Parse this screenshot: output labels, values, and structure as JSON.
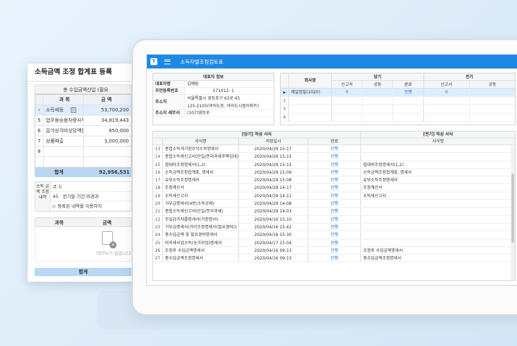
{
  "back": {
    "title": "소득금액 조정 합계표 등록",
    "subheader": "총 수입금액산입 (필요",
    "head": {
      "col1": "과 목",
      "col2": "금 액"
    },
    "rows": [
      {
        "num": "",
        "name": "소득세등",
        "amount": "53,700,200"
      },
      {
        "num": "5",
        "name": "업무용승용차량사적",
        "amount": "34,819,443"
      },
      {
        "num": "6",
        "name": "감가상각비상당액한",
        "amount": "650,000"
      },
      {
        "num": "7",
        "name": "상품매출",
        "amount": "3,000,000"
      },
      {
        "num": "8",
        "name": "",
        "amount": ""
      }
    ],
    "total_label": "합계",
    "total_value": "92,956,531",
    "income_label": "소득 금액 조정 내역",
    "income_code_label": "코 드",
    "income_code": "45",
    "income_desc": "전기말 기간 미경과",
    "income_note": "▷ 등록된 내역을 이용하지",
    "empty_head": {
      "col1": "과목",
      "col2": "금액"
    },
    "empty_text": "데이터가 없습니다",
    "total2_label": "합계"
  },
  "app": {
    "title": "소득자별조정검토표",
    "logo": "T"
  },
  "rep": {
    "header": "대표자 정보",
    "name_label": "대표자명",
    "name": "김예림",
    "rrn_label": "주민등록번호",
    "rrn": "571012-    1",
    "addr_label": "주소지",
    "addr1": "서울특별시 영등포구 63로 45",
    "addr2": "125-2105(여의도동, 여의도시범아파트)",
    "tax_label": "주소지 세무서",
    "tax": "(107)영등포"
  },
  "periods": {
    "name_header": "회사명",
    "current": "당기",
    "previous": "전기",
    "sub": [
      "신고서",
      "공동",
      "완료"
    ],
    "prev_sub": [
      "신고서",
      "공동"
    ],
    "rows": [
      {
        "num": "",
        "name": "제일정밀(1020)",
        "cur": [
          "0",
          "",
          "진행"
        ],
        "prev": [
          "0",
          ""
        ]
      },
      {
        "num": "2",
        "name": "",
        "cur": [
          "",
          "",
          ""
        ],
        "prev": [
          "",
          ""
        ]
      },
      {
        "num": "3",
        "name": "",
        "cur": [
          "",
          "",
          ""
        ],
        "prev": [
          "",
          ""
        ]
      },
      {
        "num": "4",
        "name": "",
        "cur": [
          "",
          "",
          ""
        ],
        "prev": [
          "",
          ""
        ]
      }
    ]
  },
  "lower": {
    "h_current": "[당기] 작성 서식",
    "h_previous": "[전기] 작성 서식",
    "col_form": "서식명",
    "col_saved": "저장일시",
    "col_done": "완료",
    "col_prev_form": "서식명",
    "rows": [
      {
        "n": "13",
        "form": "종합소득과기장수익소득명세서",
        "saved": "2020/04/29 15:17",
        "done": "진행",
        "prev": ""
      },
      {
        "n": "14",
        "form": "종합소득세신고서(단일/분리과세주택임대)",
        "saved": "2020/04/29 15:15",
        "done": "진행",
        "prev": ""
      },
      {
        "n": "15",
        "form": "접대비조정명세서(1,2)",
        "saved": "2020/04/29 15:15",
        "done": "진행",
        "prev": "접대비조정명세서(1,2)"
      },
      {
        "n": "16",
        "form": "소득금액조정합계표, 명세서",
        "saved": "2020/04/29 15:09",
        "done": "진행",
        "prev": "소득금액조정합계표, 명세서"
      },
      {
        "n": "17",
        "form": "유보소득조정명세서",
        "saved": "2020/04/29 15:08",
        "done": "진행",
        "prev": "유보소득조정명세서"
      },
      {
        "n": "18",
        "form": "조정계산서",
        "saved": "2020/04/29 14:17",
        "done": "진행",
        "prev": "조정계산서"
      },
      {
        "n": "19",
        "form": "소득세신고서",
        "saved": "2020/04/29 14:11",
        "done": "진행",
        "prev": "소득세신고서"
      },
      {
        "n": "20",
        "form": "가부금명세서(4번/소득공제)",
        "saved": "2020/04/29 14:08",
        "done": "진행",
        "prev": ""
      },
      {
        "n": "21",
        "form": "종합소득세신고서(단일/분리과세)",
        "saved": "2020/04/29 14:03",
        "done": "진행",
        "prev": ""
      },
      {
        "n": "22",
        "form": "무실감가자를명세서(가증명서)",
        "saved": "2020/04/16 15:10",
        "done": "진행",
        "prev": ""
      },
      {
        "n": "23",
        "form": "기부금명세서(가이조정명세서(필요경비))",
        "saved": "2020/04/16 15:42",
        "done": "진행",
        "prev": ""
      },
      {
        "n": "24",
        "form": "총수입금액 및 필요경비명세서",
        "saved": "2020/04/16 15:30",
        "done": "진행",
        "prev": ""
      },
      {
        "n": "25",
        "form": "비과세사업소득(농가부업)명세서",
        "saved": "2020/04/17 15:04",
        "done": "진행",
        "prev": ""
      },
      {
        "n": "26",
        "form": "조정후 수입금액명세서",
        "saved": "2020/04/16 09:13",
        "done": "진행",
        "prev": "조정후 수입금액명세서"
      },
      {
        "n": "27",
        "form": "총수입금액조정명세서",
        "saved": "2020/04/16 09:13",
        "done": "진행",
        "prev": "총수입금액조정명세서"
      }
    ]
  }
}
